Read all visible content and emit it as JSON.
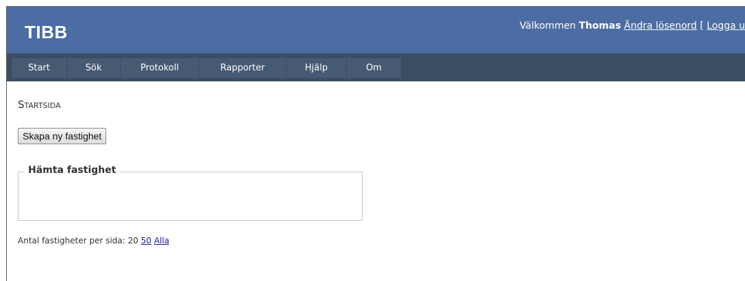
{
  "header": {
    "logo": "TIBB",
    "welcome": "Välkommen",
    "user_name": "Thomas",
    "change_password": "Ändra lösenord",
    "bracket_open": "[",
    "logout": "Logga u"
  },
  "menu": {
    "items": [
      {
        "label": "Start"
      },
      {
        "label": "Sök"
      },
      {
        "label": "Protokoll"
      },
      {
        "label": "Rapporter"
      },
      {
        "label": "Hjälp"
      },
      {
        "label": "Om"
      }
    ]
  },
  "main": {
    "title": "Startsida",
    "create_button": "Skapa ny fastighet",
    "fetch_legend": "Hämta fastighet",
    "paging": {
      "label": "Antal fastigheter per sida:",
      "current": "20",
      "option_50": "50",
      "option_all": "Alla"
    }
  },
  "colors": {
    "header_bg": "#4b6da3",
    "nav_bg": "#3a4d63",
    "menu_item_bg": "#465a72",
    "link": "#1a1a9e"
  }
}
